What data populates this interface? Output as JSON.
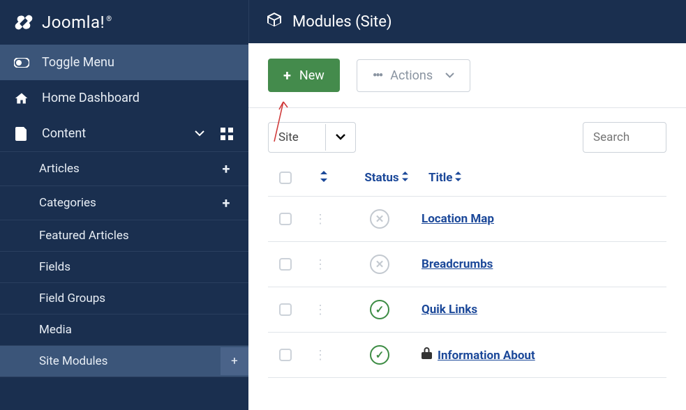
{
  "brand": "Joomla!",
  "sidebar": {
    "toggle": "Toggle Menu",
    "home": "Home Dashboard",
    "content": "Content",
    "articles": "Articles",
    "categories": "Categories",
    "featured": "Featured Articles",
    "fields": "Fields",
    "fieldgroups": "Field Groups",
    "media": "Media",
    "sitemodules": "Site Modules"
  },
  "header": {
    "title": "Modules (Site)"
  },
  "toolbar": {
    "new": "New",
    "actions": "Actions"
  },
  "filter": {
    "site": "Site",
    "search_placeholder": "Search"
  },
  "columns": {
    "status": "Status",
    "title": "Title"
  },
  "rows": [
    {
      "title": "Location Map",
      "status": "unpublished",
      "locked": false
    },
    {
      "title": "Breadcrumbs",
      "status": "unpublished",
      "locked": false
    },
    {
      "title": "Quik Links",
      "status": "published",
      "locked": false
    },
    {
      "title": "Information About",
      "status": "published",
      "locked": true
    }
  ]
}
